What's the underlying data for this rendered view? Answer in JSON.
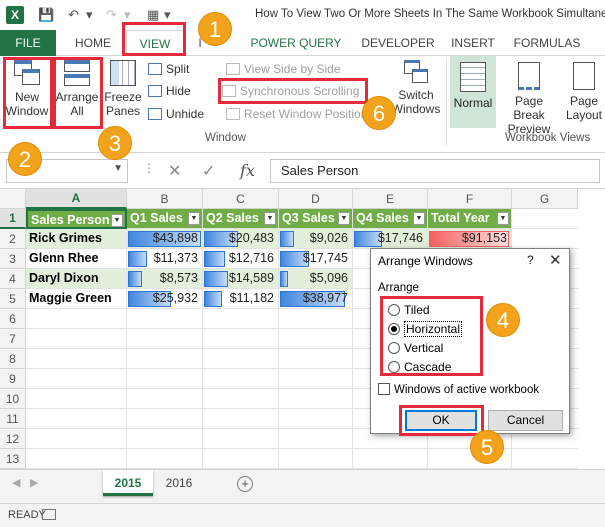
{
  "app": {
    "logo": "X",
    "title": "How To View Two Or More Sheets In The Same Workbook Simultaneously"
  },
  "tabs": [
    "FILE",
    "HOME",
    "VIEW",
    "I",
    "POWER QUERY",
    "DEVELOPER",
    "INSERT",
    "FORMULAS"
  ],
  "ribbon": {
    "new_window": [
      "New",
      "Window"
    ],
    "arrange_all": [
      "Arrange",
      "All"
    ],
    "freeze_panes": [
      "Freeze",
      "Panes"
    ],
    "split": "Split",
    "hide": "Hide",
    "unhide": "Unhide",
    "view_side_by_side": "View Side by Side",
    "synchronous_scrolling": "Synchronous Scrolling",
    "reset_window_position": "Reset Window Position",
    "switch_windows": [
      "Switch",
      "Windows"
    ],
    "normal": "Normal",
    "page_break_preview": [
      "Page Break",
      "Preview"
    ],
    "page_layout": [
      "Page",
      "Layout"
    ],
    "group_window": "Window",
    "group_workbook_views": "Workbook Views"
  },
  "formula_bar": {
    "name_box": "",
    "content": "Sales Person",
    "fx": "fx"
  },
  "columns": [
    "A",
    "B",
    "C",
    "D",
    "E",
    "F",
    "G"
  ],
  "rows": [
    "1",
    "2",
    "3",
    "4",
    "5",
    "6",
    "7",
    "8",
    "9",
    "10",
    "11",
    "12",
    "13"
  ],
  "table": {
    "headers": [
      "Sales Person",
      "Q1 Sales",
      "Q2 Sales",
      "Q3 Sales",
      "Q4 Sales",
      "Total Year"
    ],
    "data": [
      {
        "name": "Rick Grimes",
        "q1": "$43,898",
        "q2": "$20,483",
        "q3": "$9,026",
        "q4": "$17,746",
        "total": "$91,153"
      },
      {
        "name": "Glenn Rhee",
        "q1": "$11,373",
        "q2": "$12,716",
        "q3": "$17,745",
        "q4": "",
        "total": ""
      },
      {
        "name": "Daryl Dixon",
        "q1": "$8,573",
        "q2": "$14,589",
        "q3": "$5,096",
        "q4": "",
        "total": ""
      },
      {
        "name": "Maggie Green",
        "q1": "$25,932",
        "q2": "$11,182",
        "q3": "$38,977",
        "q4": "",
        "total": ""
      }
    ]
  },
  "sheets": [
    "2015",
    "2016"
  ],
  "status": "READY",
  "dialog": {
    "title": "Arrange Windows",
    "help": "?",
    "close": "✕",
    "group_label": "Arrange",
    "options": [
      "Tiled",
      "Horizontal",
      "Vertical",
      "Cascade"
    ],
    "selected": "Horizontal",
    "checkbox_label": "Windows of active workbook",
    "ok": "OK",
    "cancel": "Cancel"
  },
  "callouts": [
    "1",
    "2",
    "3",
    "4",
    "5",
    "6"
  ],
  "colors": {
    "excel_green": "#217346",
    "header_green": "#70ad47",
    "callout_orange": "#f3a31b",
    "highlight_red": "#e7293c"
  }
}
